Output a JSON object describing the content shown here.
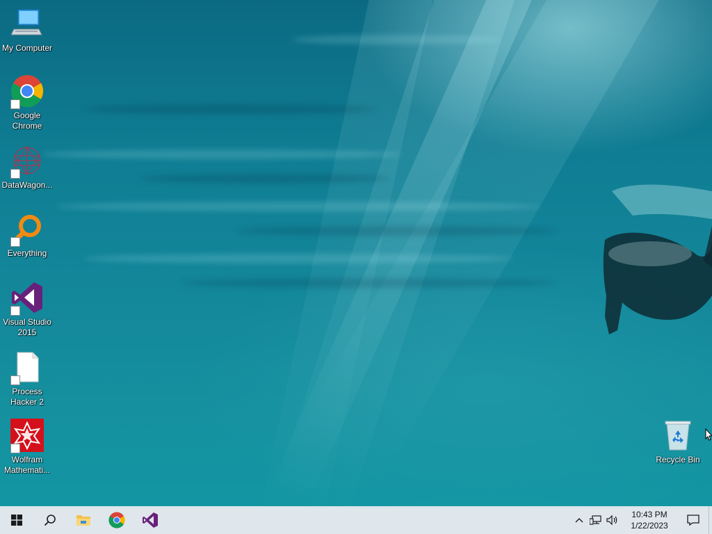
{
  "desktop": {
    "icons": [
      {
        "label": "My Computer",
        "icon": "computer-icon"
      },
      {
        "label": "Google Chrome",
        "icon": "chrome-icon"
      },
      {
        "label": "DataWagon...",
        "icon": "datawagon-icon"
      },
      {
        "label": "Everything",
        "icon": "everything-search-icon"
      },
      {
        "label": "Visual Studio 2015",
        "icon": "visual-studio-icon"
      },
      {
        "label": "Process Hacker 2",
        "icon": "blank-file-icon"
      },
      {
        "label": "Wolfram Mathemati...",
        "icon": "wolfram-mathematica-icon"
      },
      {
        "label": "Recycle Bin",
        "icon": "recycle-bin-icon"
      }
    ]
  },
  "taskbar": {
    "pinned": [
      "start-icon",
      "search-icon",
      "file-explorer-icon",
      "chrome-icon",
      "visual-studio-icon"
    ],
    "tray": {
      "time": "10:43 PM",
      "date": "1/22/2023"
    }
  },
  "colors": {
    "taskbar_bg": "#dfe6ec",
    "water": "#0f7d93",
    "vs_purple": "#68217a",
    "wolfram_red": "#d4111b",
    "everything_orange": "#f28a12"
  }
}
